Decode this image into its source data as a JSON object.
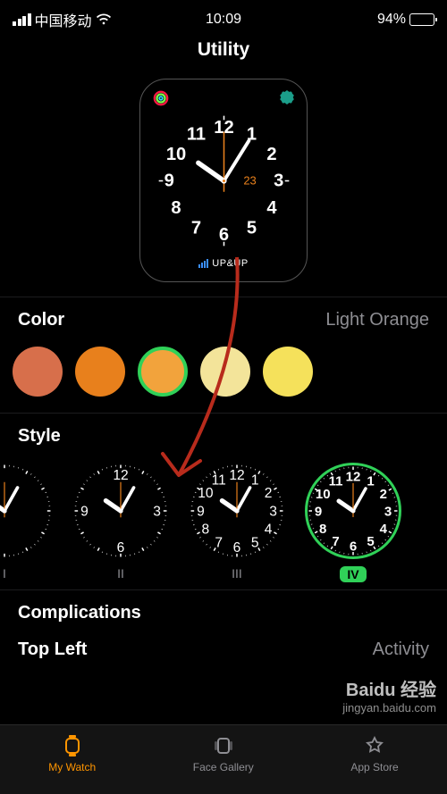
{
  "status": {
    "carrier": "中国移动",
    "time": "10:09",
    "battery_pct": "94%"
  },
  "title": "Utility",
  "preview": {
    "date": "23",
    "bottom_text": "UP&UP"
  },
  "sections": {
    "color": {
      "label": "Color",
      "value": "Light Orange"
    },
    "style": {
      "label": "Style"
    },
    "complications": {
      "label": "Complications"
    },
    "top_left": {
      "label": "Top Left",
      "value": "Activity"
    }
  },
  "colors": {
    "swatches": [
      "#c04f3d",
      "#d76f4b",
      "#e8801c",
      "#f2a33c",
      "#f3e49a",
      "#f5e15b"
    ],
    "selected_index": 3
  },
  "styles": {
    "items": [
      {
        "label": "I",
        "numerals": "roman-sparse"
      },
      {
        "label": "II",
        "numerals": "arabic-quarters"
      },
      {
        "label": "III",
        "numerals": "arabic-all-light"
      },
      {
        "label": "IV",
        "numerals": "arabic-all-bold"
      }
    ],
    "selected_index": 3
  },
  "tabs": {
    "items": [
      "My Watch",
      "Face Gallery",
      "App Store"
    ],
    "active_index": 0
  },
  "watermark": {
    "brand": "Baidu 经验",
    "url": "jingyan.baidu.com"
  }
}
